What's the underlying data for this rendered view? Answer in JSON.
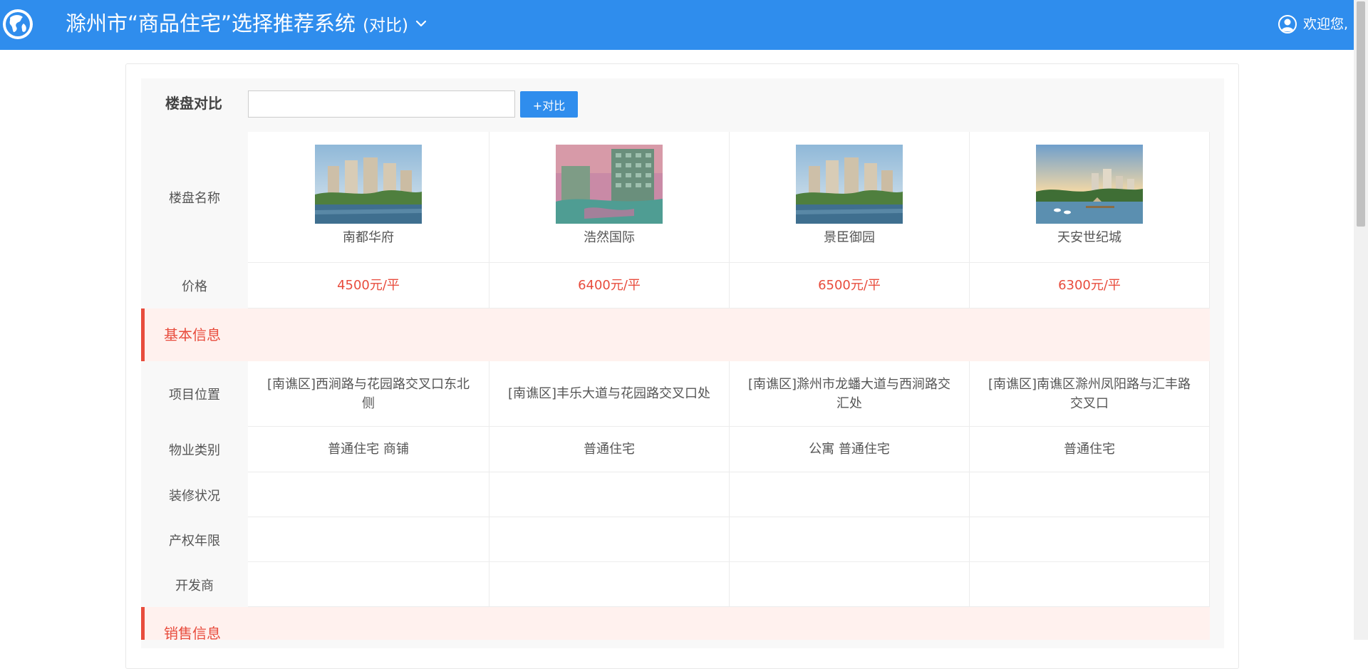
{
  "header": {
    "title": "滁州市“商品住宅”选择推荐系统",
    "subtitle": "(对比)",
    "welcome": "欢迎您,"
  },
  "compare": {
    "title": "楼盘对比",
    "input_value": "",
    "button_label": "+对比"
  },
  "rows": {
    "name_label": "楼盘名称",
    "price_label": "价格",
    "location_label": "项目位置",
    "type_label": "物业类别",
    "decoration_label": "装修状况",
    "tenure_label": "产权年限",
    "developer_label": "开发商"
  },
  "sections": {
    "basic": "基本信息",
    "sales": "销售信息"
  },
  "properties": [
    {
      "name": "南都华府",
      "price": "4500元/平",
      "location": "[南谯区]西涧路与花园路交叉口东北侧",
      "type": "普通住宅 商铺",
      "decoration": "",
      "tenure": "",
      "developer": ""
    },
    {
      "name": "浩然国际",
      "price": "6400元/平",
      "location": "[南谯区]丰乐大道与花园路交叉口处",
      "type": "普通住宅",
      "decoration": "",
      "tenure": "",
      "developer": ""
    },
    {
      "name": "景臣御园",
      "price": "6500元/平",
      "location": "[南谯区]滁州市龙蟠大道与西涧路交汇处",
      "type": "公寓 普通住宅",
      "decoration": "",
      "tenure": "",
      "developer": ""
    },
    {
      "name": "天安世纪城",
      "price": "6300元/平",
      "location": "[南谯区]南谯区滁州凤阳路与汇丰路交叉口",
      "type": "普通住宅",
      "decoration": "",
      "tenure": "",
      "developer": ""
    }
  ],
  "colors": {
    "brand": "#2f8ded",
    "accent": "#e84c3d",
    "section_bg": "#fff1ee"
  },
  "icons": {
    "logo": "globe-icon",
    "menu": "chevron-down-icon",
    "user": "user-icon"
  }
}
